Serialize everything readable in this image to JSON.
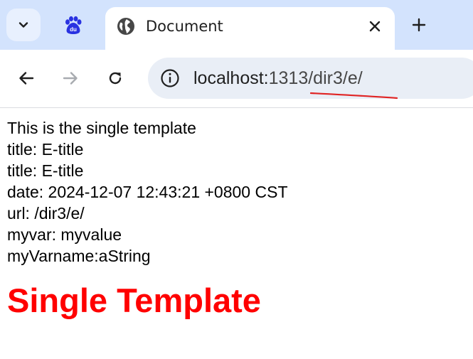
{
  "browser": {
    "active_tab": {
      "title": "Document",
      "icon": "globe-icon"
    },
    "baidu_tab": {
      "icon": "baidu-paw-icon",
      "icon_text": "du",
      "color": "#2932e1"
    },
    "address_bar": {
      "host": "localhost:",
      "path": "1313/dir3/e/",
      "underline_color": "#e02424"
    },
    "colors": {
      "tabstrip": "#d3e3fd",
      "omnibox": "#e9eef6"
    }
  },
  "page": {
    "lines": [
      "This is the single template",
      "title: E-title",
      "title: E-title",
      "date: 2024-12-07 12:43:21 +0800 CST",
      "url: /dir3/e/",
      "myvar: myvalue",
      "myVarname:aString"
    ],
    "heading": "Single Template",
    "heading_color": "#ff0000"
  }
}
